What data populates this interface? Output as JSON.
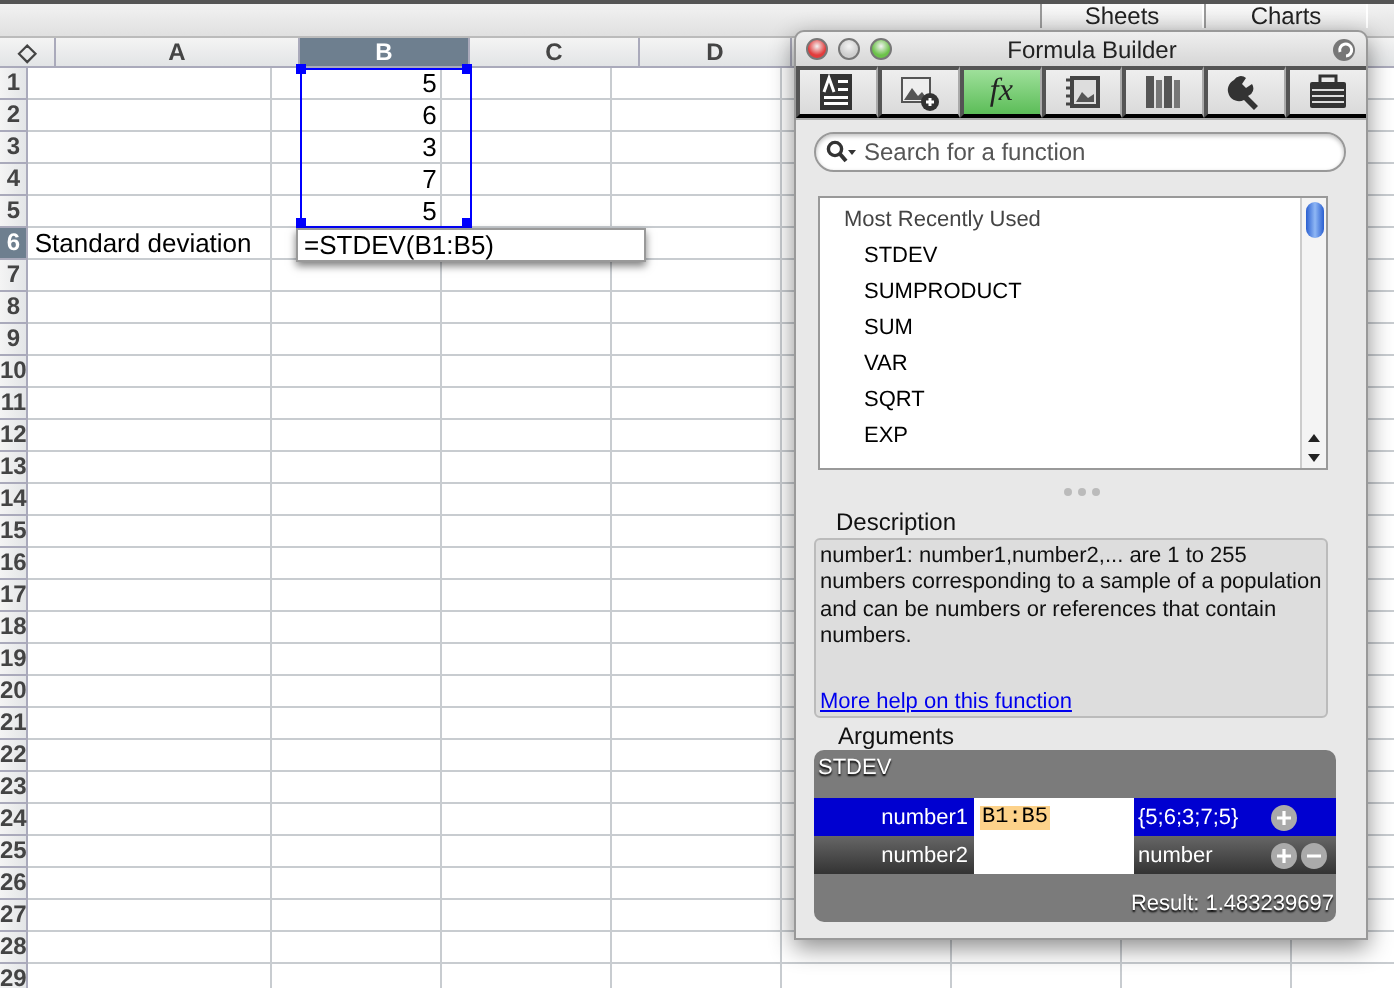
{
  "top_tabs": [
    {
      "label": "Sheets"
    },
    {
      "label": "Charts"
    }
  ],
  "sheet": {
    "corner": "◇",
    "columns": [
      {
        "label": "A",
        "selected": false
      },
      {
        "label": "B",
        "selected": true
      },
      {
        "label": "C",
        "selected": false
      },
      {
        "label": "D",
        "selected": false
      }
    ],
    "rows": [
      {
        "label": "1",
        "selected": false,
        "cells": [
          "",
          "5"
        ]
      },
      {
        "label": "2",
        "selected": false,
        "cells": [
          "",
          "6"
        ]
      },
      {
        "label": "3",
        "selected": false,
        "cells": [
          "",
          "3"
        ]
      },
      {
        "label": "4",
        "selected": false,
        "cells": [
          "",
          "7"
        ]
      },
      {
        "label": "5",
        "selected": false,
        "cells": [
          "",
          "5"
        ]
      },
      {
        "label": "6",
        "selected": true,
        "cells": [
          "Standard deviation",
          ""
        ]
      },
      {
        "label": "7",
        "selected": false,
        "cells": []
      },
      {
        "label": "8",
        "selected": false,
        "cells": []
      },
      {
        "label": "9",
        "selected": false,
        "cells": []
      },
      {
        "label": "10",
        "selected": false,
        "cells": []
      },
      {
        "label": "11",
        "selected": false,
        "cells": []
      },
      {
        "label": "12",
        "selected": false,
        "cells": []
      },
      {
        "label": "13",
        "selected": false,
        "cells": []
      },
      {
        "label": "14",
        "selected": false,
        "cells": []
      },
      {
        "label": "15",
        "selected": false,
        "cells": []
      },
      {
        "label": "16",
        "selected": false,
        "cells": []
      },
      {
        "label": "17",
        "selected": false,
        "cells": []
      },
      {
        "label": "18",
        "selected": false,
        "cells": []
      },
      {
        "label": "19",
        "selected": false,
        "cells": []
      },
      {
        "label": "20",
        "selected": false,
        "cells": []
      },
      {
        "label": "21",
        "selected": false,
        "cells": []
      },
      {
        "label": "22",
        "selected": false,
        "cells": []
      },
      {
        "label": "23",
        "selected": false,
        "cells": []
      },
      {
        "label": "24",
        "selected": false,
        "cells": []
      },
      {
        "label": "25",
        "selected": false,
        "cells": []
      },
      {
        "label": "26",
        "selected": false,
        "cells": []
      },
      {
        "label": "27",
        "selected": false,
        "cells": []
      },
      {
        "label": "28",
        "selected": false,
        "cells": []
      },
      {
        "label": "29",
        "selected": false,
        "cells": []
      }
    ],
    "formula_editor": {
      "value": "=STDEV(B1:B5)"
    }
  },
  "formula_builder": {
    "title": "Formula Builder",
    "tabs": [
      {
        "kind": "text",
        "selected": false
      },
      {
        "kind": "image",
        "selected": false
      },
      {
        "kind": "function",
        "label": "fx",
        "selected": true
      },
      {
        "kind": "media",
        "selected": false
      },
      {
        "kind": "library",
        "selected": false
      },
      {
        "kind": "tools",
        "selected": false
      },
      {
        "kind": "inspector",
        "selected": false
      }
    ],
    "search": {
      "placeholder": "Search for a function"
    },
    "function_list": {
      "group": "Most Recently Used",
      "items": [
        "STDEV",
        "SUMPRODUCT",
        "SUM",
        "VAR",
        "SQRT",
        "EXP"
      ]
    },
    "description": {
      "label": "Description",
      "text": "number1: number1,number2,... are 1 to 255 numbers corresponding to a sample of a population and can be numbers or references that contain numbers.",
      "link": "More help on this function"
    },
    "arguments": {
      "label": "Arguments",
      "function": "STDEV",
      "rows": [
        {
          "name": "number1",
          "value": "B1:B5",
          "evaluated": "{5;6;3;7;5}",
          "selected": true,
          "removable": false
        },
        {
          "name": "number2",
          "value": "",
          "evaluated": "number",
          "selected": false,
          "removable": true
        }
      ],
      "result": "Result: 1.483239697"
    }
  }
}
